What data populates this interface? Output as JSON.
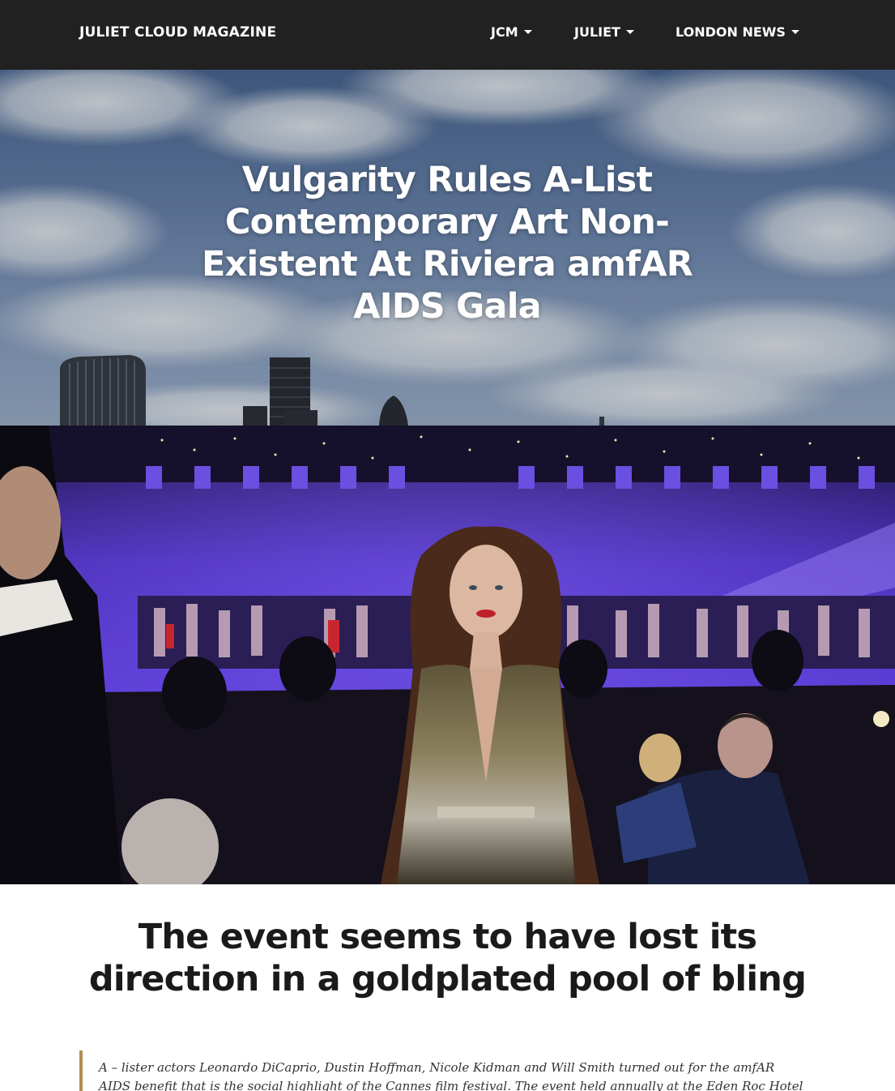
{
  "navbar": {
    "brand": "JULIET CLOUD MAGAZINE",
    "items": [
      {
        "label": "JCM",
        "dropdown": true
      },
      {
        "label": "JULIET",
        "dropdown": true
      },
      {
        "label": "LONDON NEWS",
        "dropdown": true
      }
    ]
  },
  "hero": {
    "title": "Vulgarity Rules A-List Contemporary Art Non-Existent At Riviera amfAR AIDS Gala"
  },
  "article": {
    "subtitle": "The event seems to have lost its direction in a goldplated pool of bling",
    "quote": "A – lister actors Leonardo DiCaprio, Dustin Hoffman, Nicole Kidman and Will Smith turned out for the amfAR AIDS benefit that is the social highlight of the Cannes film festival. The event held annually at the Eden Roc Hotel"
  },
  "colors": {
    "navbar_bg": "#212121",
    "quote_border": "#b08d57"
  }
}
